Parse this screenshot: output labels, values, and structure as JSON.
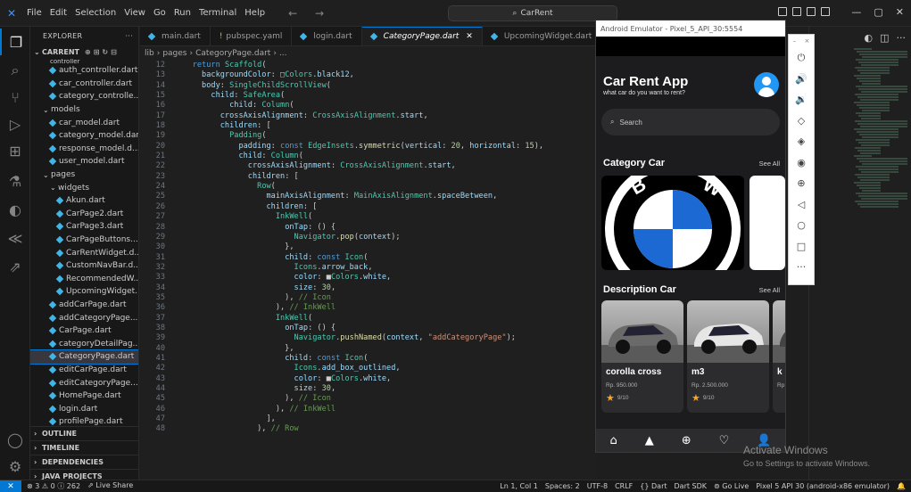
{
  "titlebar": {
    "menu": [
      "File",
      "Edit",
      "Selection",
      "View",
      "Go",
      "Run",
      "Terminal",
      "Help"
    ],
    "search": "CarRent",
    "nav": "← →",
    "window_controls": [
      "—",
      "▢",
      "✕"
    ]
  },
  "explorer": {
    "header": "EXPLORER",
    "header_more": "···",
    "project": "CARRENT",
    "partial_top": "controller",
    "items": [
      {
        "label": "auth_controller.dart",
        "indent": 2,
        "kind": "file"
      },
      {
        "label": "car_controller.dart",
        "indent": 2,
        "kind": "file"
      },
      {
        "label": "category_controlle...",
        "indent": 2,
        "kind": "file"
      },
      {
        "label": "models",
        "indent": 1,
        "kind": "folder"
      },
      {
        "label": "car_model.dart",
        "indent": 2,
        "kind": "file"
      },
      {
        "label": "category_model.dart",
        "indent": 2,
        "kind": "file"
      },
      {
        "label": "response_model.d...",
        "indent": 2,
        "kind": "file"
      },
      {
        "label": "user_model.dart",
        "indent": 2,
        "kind": "file"
      },
      {
        "label": "pages",
        "indent": 1,
        "kind": "folder"
      },
      {
        "label": "widgets",
        "indent": 2,
        "kind": "folder"
      },
      {
        "label": "Akun.dart",
        "indent": 3,
        "kind": "file"
      },
      {
        "label": "CarPage2.dart",
        "indent": 3,
        "kind": "file"
      },
      {
        "label": "CarPage3.dart",
        "indent": 3,
        "kind": "file"
      },
      {
        "label": "CarPageButtons....",
        "indent": 3,
        "kind": "file"
      },
      {
        "label": "CarRentWidget.d...",
        "indent": 3,
        "kind": "file"
      },
      {
        "label": "CustomNavBar.d...",
        "indent": 3,
        "kind": "file"
      },
      {
        "label": "RecommendedW...",
        "indent": 3,
        "kind": "file"
      },
      {
        "label": "UpcomingWidget... ←",
        "indent": 3,
        "kind": "file"
      },
      {
        "label": "addCarPage.dart",
        "indent": 2,
        "kind": "file"
      },
      {
        "label": "addCategoryPage....",
        "indent": 2,
        "kind": "file"
      },
      {
        "label": "CarPage.dart",
        "indent": 2,
        "kind": "file"
      },
      {
        "label": "categoryDetailPag...",
        "indent": 2,
        "kind": "file"
      },
      {
        "label": "CategoryPage.dart",
        "indent": 2,
        "kind": "file",
        "selected": true
      },
      {
        "label": "editCarPage.dart",
        "indent": 2,
        "kind": "file"
      },
      {
        "label": "editCategoryPage....",
        "indent": 2,
        "kind": "file"
      },
      {
        "label": "HomePage.dart",
        "indent": 2,
        "kind": "file"
      },
      {
        "label": "login.dart",
        "indent": 2,
        "kind": "file"
      },
      {
        "label": "profilePage.dart",
        "indent": 2,
        "kind": "file"
      }
    ],
    "sections": [
      "OUTLINE",
      "TIMELINE",
      "DEPENDENCIES",
      "JAVA PROJECTS"
    ]
  },
  "tabs": [
    {
      "label": "main.dart",
      "icon": "dart"
    },
    {
      "label": "pubspec.yaml",
      "icon": "yaml"
    },
    {
      "label": "login.dart",
      "icon": "dart"
    },
    {
      "label": "CategoryPage.dart",
      "icon": "dart",
      "active": true
    },
    {
      "label": "UpcomingWidget.dart",
      "icon": "dart"
    }
  ],
  "breadcrumb": [
    "lib",
    "pages",
    "CategoryPage.dart",
    "..."
  ],
  "code": [
    {
      "n": "12",
      "html": "    <span class='k'>return</span> <span class='c'>Scaffold</span>("
    },
    {
      "n": "13",
      "html": "      <span class='p'>backgroundColor</span>: □<span class='c'>Colors</span>.<span class='p'>black12</span>,"
    },
    {
      "n": "14",
      "html": "      <span class='p'>body</span>: <span class='c'>SingleChildScrollView</span>("
    },
    {
      "n": "15",
      "html": "        <span class='p'>child</span>: <span class='c'>SafeArea</span>("
    },
    {
      "n": "16",
      "html": "            <span class='p'>child</span>: <span class='c'>Column</span>("
    },
    {
      "n": "17",
      "html": "          <span class='p'>crossAxisAlignment</span>: <span class='c'>CrossAxisAlignment</span>.<span class='p'>start</span>,"
    },
    {
      "n": "18",
      "html": "          <span class='p'>children</span>: ["
    },
    {
      "n": "19",
      "html": "            <span class='c'>Padding</span>("
    },
    {
      "n": "20",
      "html": "              <span class='p'>padding</span>: <span class='k'>const</span> <span class='c'>EdgeInsets</span>.<span class='f'>symmetric</span>(<span class='p'>vertical</span>: <span class='n'>20</span>, <span class='p'>horizontal</span>: <span class='n'>15</span>),"
    },
    {
      "n": "21",
      "html": "              <span class='p'>child</span>: <span class='c'>Column</span>("
    },
    {
      "n": "22",
      "html": "                <span class='p'>crossAxisAlignment</span>: <span class='c'>CrossAxisAlignment</span>.<span class='p'>start</span>,"
    },
    {
      "n": "23",
      "html": "                <span class='p'>children</span>: ["
    },
    {
      "n": "24",
      "html": "                  <span class='c'>Row</span>("
    },
    {
      "n": "25",
      "html": "                    <span class='p'>mainAxisAlignment</span>: <span class='c'>MainAxisAlignment</span>.<span class='p'>spaceBetween</span>,"
    },
    {
      "n": "26",
      "html": "                    <span class='p'>children</span>: ["
    },
    {
      "n": "27",
      "html": "                      <span class='c'>InkWell</span>("
    },
    {
      "n": "28",
      "html": "                        <span class='p'>onTap</span>: () {"
    },
    {
      "n": "29",
      "html": "                          <span class='c'>Navigator</span>.<span class='f'>pop</span>(<span class='p'>context</span>);"
    },
    {
      "n": "30",
      "html": "                        },"
    },
    {
      "n": "31",
      "html": "                        <span class='p'>child</span>: <span class='k'>const</span> <span class='c'>Icon</span>("
    },
    {
      "n": "32",
      "html": "                          <span class='c'>Icons</span>.<span class='p'>arrow_back</span>,"
    },
    {
      "n": "33",
      "html": "                          <span class='p'>color</span>: ■<span class='c'>Colors</span>.<span class='p'>white</span>,"
    },
    {
      "n": "34",
      "html": "                          <span class='p'>size</span>: <span class='n'>30</span>,"
    },
    {
      "n": "35",
      "html": "                        ), <span class='cm'>// Icon</span>"
    },
    {
      "n": "36",
      "html": "                      ), <span class='cm'>// InkWell</span>"
    },
    {
      "n": "37",
      "html": "                      <span class='c'>InkWell</span>("
    },
    {
      "n": "38",
      "html": "                        <span class='p'>onTap</span>: () {"
    },
    {
      "n": "39",
      "html": "                          <span class='c'>Navigator</span>.<span class='f'>pushNamed</span>(<span class='p'>context</span>, <span class='s'>\"addCategoryPage\"</span>);"
    },
    {
      "n": "40",
      "html": "                        },"
    },
    {
      "n": "41",
      "html": "                        <span class='p'>child</span>: <span class='k'>const</span> <span class='c'>Icon</span>("
    },
    {
      "n": "42",
      "html": "                          <span class='c'>Icons</span>.<span class='p'>add_box_outlined</span>,"
    },
    {
      "n": "43",
      "html": "                          <span class='p'>color</span>: ■<span class='c'>Colors</span>.<span class='p'>white</span>,"
    },
    {
      "n": "44",
      "html": "                          <span class='p'>size</span>: <span class='n'>30</span>,"
    },
    {
      "n": "45",
      "html": "                        ), <span class='cm'>// Icon</span>"
    },
    {
      "n": "46",
      "html": "                      ), <span class='cm'>// InkWell</span>"
    },
    {
      "n": "47",
      "html": "                    ],"
    },
    {
      "n": "48",
      "html": "                  ), <span class='cm'>// Row</span>"
    }
  ],
  "emulator": {
    "title": "Android Emulator - Pixel_5_API_30:5554",
    "app_title": "Car Rent App",
    "app_subtitle": "what car do you want to rent?",
    "search_placeholder": "Search",
    "category_title": "Category Car",
    "category_see_all": "See All",
    "description_title": "Description Car",
    "description_see_all": "See All",
    "cars": [
      {
        "name": "corolla cross",
        "price": "Rp. 950.000",
        "rating": "9/10"
      },
      {
        "name": "m3",
        "price": "Rp. 2.500.000",
        "rating": "9/10"
      },
      {
        "name": "k",
        "price": "Rp",
        "rating": ""
      }
    ],
    "tools": [
      "power-icon",
      "volume-up-icon",
      "volume-down-icon",
      "rotate-left-icon",
      "rotate-right-icon",
      "camera-icon",
      "zoom-icon",
      "back-icon",
      "home-icon",
      "overview-icon",
      "more-icon"
    ],
    "tool_glyphs": [
      "⏻",
      "🔊",
      "🔉",
      "◇",
      "◈",
      "◉",
      "⊕",
      "◁",
      "○",
      "□",
      "···"
    ]
  },
  "watermark": {
    "title": "Activate Windows",
    "subtitle": "Go to Settings to activate Windows."
  },
  "statusbar": {
    "problems": "⊗ 3 ⚠ 0 ⓘ 262",
    "live_share": "Live Share",
    "position": "Ln 1, Col 1",
    "spaces": "Spaces: 2",
    "encoding": "UTF-8",
    "eol": "CRLF",
    "language": "{} Dart",
    "sdk": "Dart SDK",
    "go_live": "Go Live",
    "device": "Pixel 5 API 30 (android-x86 emulator)"
  }
}
